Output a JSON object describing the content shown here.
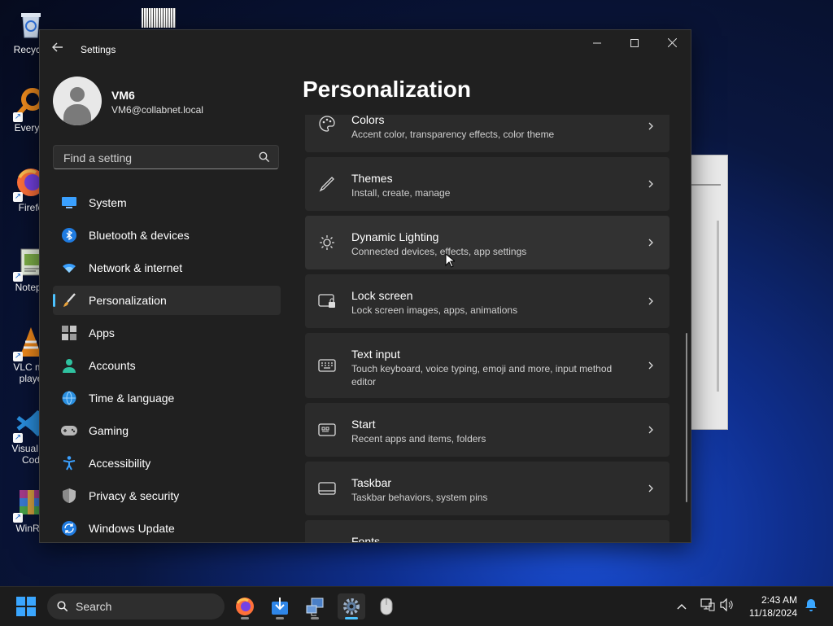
{
  "desktop": {
    "icons": [
      {
        "label": "Recycle"
      },
      {
        "label": "Everyth"
      },
      {
        "label": "Firefo"
      },
      {
        "label": "Notepa"
      },
      {
        "label": "VLC me playe"
      },
      {
        "label": "Visual St Cod"
      },
      {
        "label": "WinRA"
      }
    ]
  },
  "window": {
    "title": "Settings",
    "controls": {
      "minimize": "—",
      "maximize": "☐",
      "close": "✕"
    }
  },
  "user": {
    "name": "VM6",
    "email": "VM6@collabnet.local"
  },
  "search": {
    "placeholder": "Find a setting"
  },
  "nav": [
    {
      "label": "System"
    },
    {
      "label": "Bluetooth & devices"
    },
    {
      "label": "Network & internet"
    },
    {
      "label": "Personalization",
      "active": true
    },
    {
      "label": "Apps"
    },
    {
      "label": "Accounts"
    },
    {
      "label": "Time & language"
    },
    {
      "label": "Gaming"
    },
    {
      "label": "Accessibility"
    },
    {
      "label": "Privacy & security"
    },
    {
      "label": "Windows Update"
    }
  ],
  "page": {
    "title": "Personalization"
  },
  "cards": [
    {
      "title": "Colors",
      "subtitle": "Accent color, transparency effects, color theme"
    },
    {
      "title": "Themes",
      "subtitle": "Install, create, manage"
    },
    {
      "title": "Dynamic Lighting",
      "subtitle": "Connected devices, effects, app settings"
    },
    {
      "title": "Lock screen",
      "subtitle": "Lock screen images, apps, animations"
    },
    {
      "title": "Text input",
      "subtitle": "Touch keyboard, voice typing, emoji and more, input method editor"
    },
    {
      "title": "Start",
      "subtitle": "Recent apps and items, folders"
    },
    {
      "title": "Taskbar",
      "subtitle": "Taskbar behaviors, system pins"
    },
    {
      "title": "Fonts",
      "subtitle": ""
    }
  ],
  "taskbar": {
    "search_label": "Search",
    "time": "2:43 AM",
    "date": "11/18/2024"
  },
  "colors": {
    "accent": "#4cc2ff",
    "window_bg": "#202020",
    "card_bg": "#2b2b2b"
  }
}
